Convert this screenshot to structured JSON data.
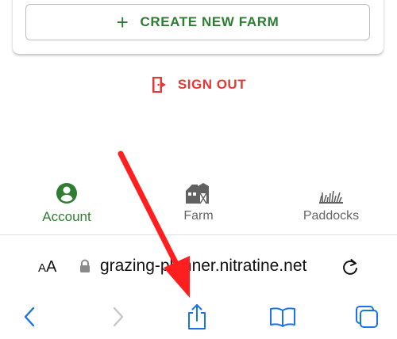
{
  "actions": {
    "create_farm_label": "CREATE NEW FARM",
    "sign_out_label": "SIGN OUT"
  },
  "tabs": [
    {
      "label": "Account",
      "icon": "account-circle-icon",
      "active": true
    },
    {
      "label": "Farm",
      "icon": "barn-icon",
      "active": false
    },
    {
      "label": "Paddocks",
      "icon": "grass-icon",
      "active": false
    }
  ],
  "browser": {
    "text_size_label": "AA",
    "url": "grazing-planner.nitratine.net",
    "toolbar": [
      "back-icon",
      "forward-icon",
      "share-icon",
      "bookmarks-icon",
      "tabs-icon"
    ]
  },
  "colors": {
    "primary_green": "#2e7d32",
    "danger_red": "#e53935",
    "ios_blue": "#1a73e8",
    "annotation_arrow": "#ff1f1f"
  }
}
